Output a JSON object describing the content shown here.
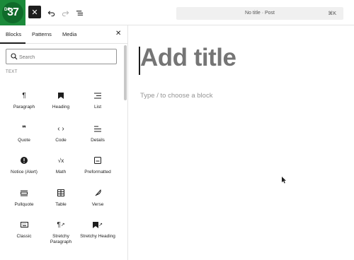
{
  "logo": {
    "text": "37",
    "prefix": "DC"
  },
  "toolbar": {
    "close_icon": "close-icon",
    "undo_icon": "undo-icon",
    "redo_icon": "redo-icon",
    "outline_icon": "document-overview-icon",
    "document_title": "No title · Post",
    "shortcut": "⌘K"
  },
  "sidebar": {
    "tabs": [
      "Blocks",
      "Patterns",
      "Media"
    ],
    "active_tab": "Blocks",
    "search": {
      "placeholder": "Search",
      "value": ""
    },
    "category": "TEXT",
    "blocks": [
      {
        "label": "Paragraph",
        "icon": "¶"
      },
      {
        "label": "Heading",
        "icon": "bookmark"
      },
      {
        "label": "List",
        "icon": "list"
      },
      {
        "label": "Quote",
        "icon": "❞"
      },
      {
        "label": "Code",
        "icon": "‹ ›"
      },
      {
        "label": "Details",
        "icon": "details"
      },
      {
        "label": "Notice (Alert)",
        "icon": "!"
      },
      {
        "label": "Math",
        "icon": "√x"
      },
      {
        "label": "Preformatted",
        "icon": "preformatted"
      },
      {
        "label": "Pullquote",
        "icon": "pullquote"
      },
      {
        "label": "Table",
        "icon": "table"
      },
      {
        "label": "Verse",
        "icon": "feather"
      },
      {
        "label": "Classic",
        "icon": "keyboard"
      },
      {
        "label": "Stretchy Paragraph",
        "icon": "¶↗"
      },
      {
        "label": "Stretchy Heading",
        "icon": "bookmark-arrow"
      }
    ]
  },
  "editor": {
    "title_placeholder": "Add title",
    "block_prompt": "Type / to choose a block"
  },
  "colors": {
    "logo_green": "#1b8a3a",
    "accent_dark": "#1e1e1e",
    "muted": "#757575"
  }
}
